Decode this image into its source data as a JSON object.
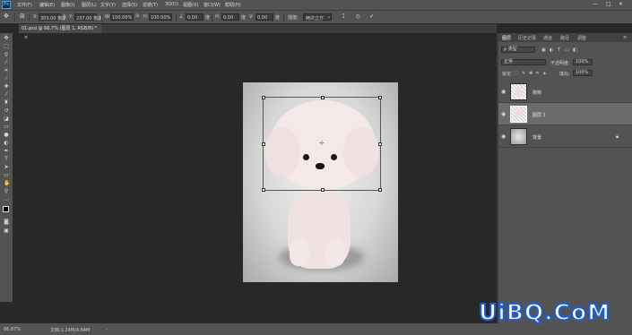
{
  "app": {
    "logo": "Ps"
  },
  "menu": [
    "文件(F)",
    "编辑(E)",
    "图像(I)",
    "图层(L)",
    "文字(Y)",
    "选择(S)",
    "滤镜(T)",
    "3D(D)",
    "视图(V)",
    "窗口(W)",
    "帮助(H)"
  ],
  "window_controls": {
    "minimize": "—",
    "restore": "□",
    "close": "✕"
  },
  "options": {
    "x_label": "X:",
    "x_value": "303.00 像素",
    "y_label": "Y:",
    "y_value": "237.00 像素",
    "w_label": "W:",
    "w_value": "100.00%",
    "h_label": "H:",
    "h_value": "100.00%",
    "angle_value": "0.00",
    "hskew_label": "H:",
    "hskew_value": "0.00",
    "vskew_label": "V:",
    "vskew_value": "0.00",
    "interp_label": "插值:",
    "interp_value": "两次立方",
    "cancel_icon": "⦸",
    "commit_icon": "✓"
  },
  "document": {
    "tab_title": "01.psd @ 66.7% (图层 1, RGB/8) *",
    "tab_close": "×"
  },
  "panels": {
    "tabs": [
      "图层",
      "历史记录",
      "通道",
      "路径",
      "调整"
    ],
    "filter_label": "ρ 类型",
    "blend_mode": "正常",
    "opacity_label": "不透明度:",
    "opacity_value": "100%",
    "lock_label": "锁定:",
    "fill_label": "填充:",
    "fill_value": "100%",
    "layers": [
      {
        "name": "狗狗",
        "selected": false
      },
      {
        "name": "图层 1",
        "selected": true
      },
      {
        "name": "背景",
        "selected": false
      }
    ]
  },
  "status": {
    "zoom": "66.67%",
    "doc_size": "文档:1.24M/4.64M"
  },
  "watermark": {
    "text": "UiBQ.CoM"
  }
}
